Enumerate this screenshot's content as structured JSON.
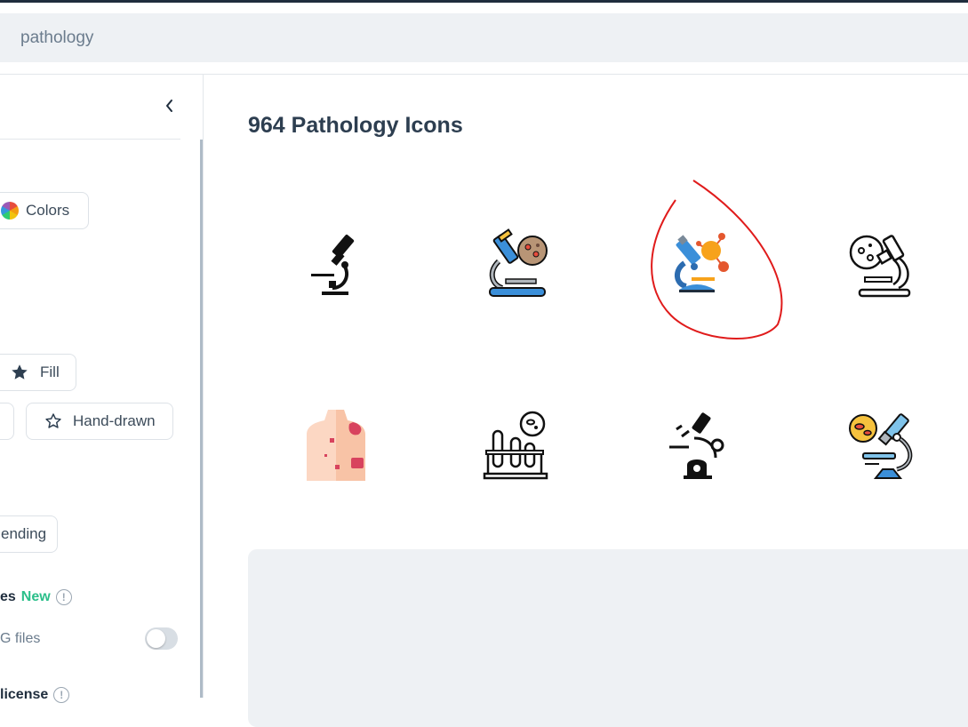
{
  "search": {
    "value": "pathology"
  },
  "sidebar": {
    "colors_label": "Colors",
    "fill_label": "Fill",
    "hand_drawn_label": "Hand-drawn",
    "trending_label": "ending",
    "file_format_label": "es",
    "new_badge": "New",
    "svg_files_label": "G files",
    "license_label": "license"
  },
  "main": {
    "title": "964 Pathology Icons",
    "icons": [
      "microscope-glyph-icon",
      "microscope-petri-lineal-color-icon",
      "microscope-molecule-flat-icon",
      "microscope-petri-outline-icon",
      "torso-skin-flat-icon",
      "test-tubes-bacteria-outline-icon",
      "microscope-robotic-glyph-icon",
      "microscope-bacteria-lineal-color-icon"
    ]
  },
  "colors": {
    "accent_new": "#2bbf8a",
    "annotation_red": "#e01b1b"
  }
}
